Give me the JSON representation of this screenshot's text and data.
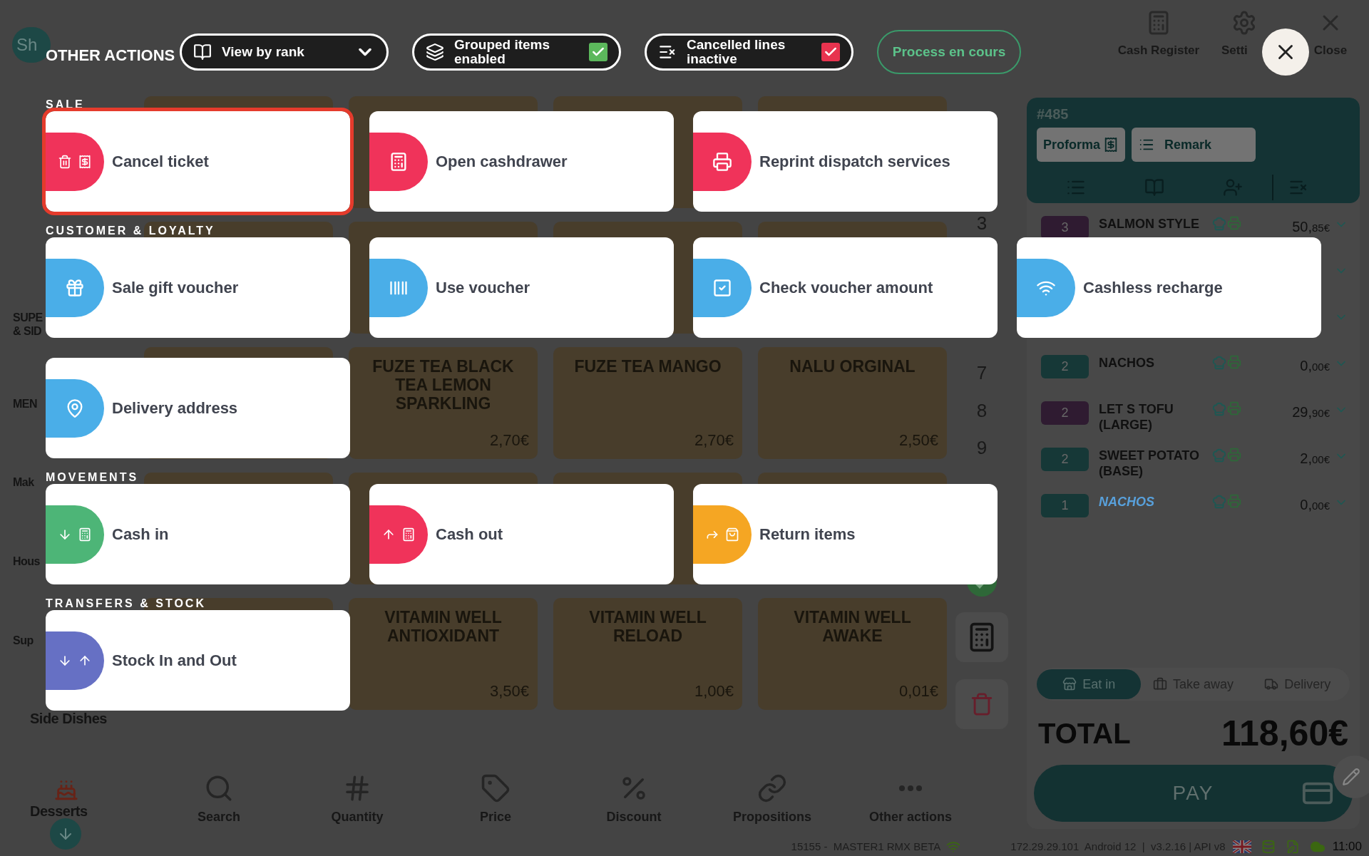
{
  "app_bar": {
    "avatar": "Sh",
    "buttons": [
      {
        "label": "Cash Register"
      },
      {
        "label": "Setti"
      },
      {
        "label": "Close"
      }
    ]
  },
  "sidebar": {
    "items": [
      {
        "lines": [
          "SUPE",
          "& SID"
        ]
      },
      {
        "lines": [
          "MEN"
        ]
      },
      {
        "lines": [
          "Mak"
        ]
      },
      {
        "lines": [
          "Hous"
        ]
      },
      {
        "lines": [
          "Sup"
        ]
      },
      {
        "lines": [
          "Side Dishes"
        ]
      },
      {
        "lines": [
          "Desserts"
        ]
      }
    ]
  },
  "products": [
    {
      "name": "FUZE TEA BLACK TEA LEMON SPARKLING",
      "price": "2,70€"
    },
    {
      "name": "FUZE TEA MANGO",
      "price": "2,70€"
    },
    {
      "name": "NALU ORGINAL",
      "price": "2,50€"
    },
    {
      "name": "VITAMIN WELL ANTIOXIDANT",
      "price": "3,50€"
    },
    {
      "name": "VITAMIN WELL RELOAD",
      "price": "1,00€"
    },
    {
      "name": "VITAMIN WELL AWAKE",
      "price": "0,01€"
    }
  ],
  "numpad": {
    "keys": [
      "3",
      "7",
      "8",
      "9"
    ]
  },
  "toolbar": {
    "items": [
      {
        "label": "Search"
      },
      {
        "label": "Quantity"
      },
      {
        "label": "Price"
      },
      {
        "label": "Discount"
      },
      {
        "label": "Propositions"
      },
      {
        "label": "Other actions"
      }
    ]
  },
  "ticket": {
    "number": "#485",
    "buttons": [
      {
        "label": "Proforma"
      },
      {
        "label": "Remark"
      }
    ],
    "lines": [
      {
        "qty": "3",
        "color": "#301c32",
        "name": "SALMON STYLE",
        "price": "50,85€",
        "kind": "item"
      },
      {
        "qty": "2",
        "color": "#173a39",
        "name": "NACHOS",
        "price": "0,00€",
        "kind": "item"
      },
      {
        "qty": "2",
        "color": "#301c32",
        "name": "LET S TOFU (LARGE)",
        "price": "29,90€",
        "kind": "item"
      },
      {
        "qty": "2",
        "color": "#173a39",
        "name": "SWEET POTATO (BASE)",
        "price": "2,00€",
        "kind": "item"
      },
      {
        "qty": "1",
        "color": "#173a39",
        "name": "NACHOS",
        "price": "0,00€",
        "kind": "sub_item"
      }
    ],
    "order_types": [
      {
        "label": "Eat in",
        "selected": true
      },
      {
        "label": "Take away",
        "selected": false
      },
      {
        "label": "Delivery",
        "selected": false
      }
    ],
    "total_label": "TOTAL",
    "total": "118,60€",
    "pay": "PAY"
  },
  "status_bar": {
    "device": "15155 -  MASTER1 RMX BETA",
    "info": "172.29.29.101  Android 12  |  v3.2.16 | API v8",
    "time": "11:00"
  },
  "overlay": {
    "title": "OTHER ACTIONS",
    "toggles": [
      {
        "kind": "dropdown",
        "label": "View by rank"
      },
      {
        "kind": "checkbox",
        "label": "Grouped items enabled",
        "checked": true,
        "color": "#5cb85c"
      },
      {
        "kind": "checkbox",
        "label": "Cancelled lines inactive",
        "checked": true,
        "color": "#e8334f"
      }
    ],
    "process": "Process en cours",
    "sections": [
      {
        "title": "SALE",
        "actions": [
          {
            "label": "Cancel ticket",
            "color": "#f0335a",
            "selected": true
          },
          {
            "label": "Open cashdrawer",
            "color": "#f0335a",
            "selected": false
          },
          {
            "label": "Reprint dispatch services",
            "color": "#f0335a",
            "selected": false
          }
        ]
      },
      {
        "title": "CUSTOMER & LOYALTY",
        "actions": [
          {
            "label": "Sale gift voucher",
            "color": "#4aaee8",
            "selected": false
          },
          {
            "label": "Use voucher",
            "color": "#4aaee8",
            "selected": false
          },
          {
            "label": "Check voucher amount",
            "color": "#4aaee8",
            "selected": false
          },
          {
            "label": "Cashless recharge",
            "color": "#4aaee8",
            "selected": false
          },
          {
            "label": "Delivery address",
            "color": "#4aaee8",
            "selected": false
          }
        ]
      },
      {
        "title": "MOVEMENTS",
        "actions": [
          {
            "label": "Cash in",
            "color": "#4db577",
            "selected": false
          },
          {
            "label": "Cash out",
            "color": "#f0335a",
            "selected": false
          },
          {
            "label": "Return items",
            "color": "#f5a623",
            "selected": false
          }
        ]
      },
      {
        "title": "TRANSFERS & STOCK",
        "actions": [
          {
            "label": "Stock In and Out",
            "color": "#6670c4",
            "selected": false
          }
        ]
      }
    ]
  }
}
